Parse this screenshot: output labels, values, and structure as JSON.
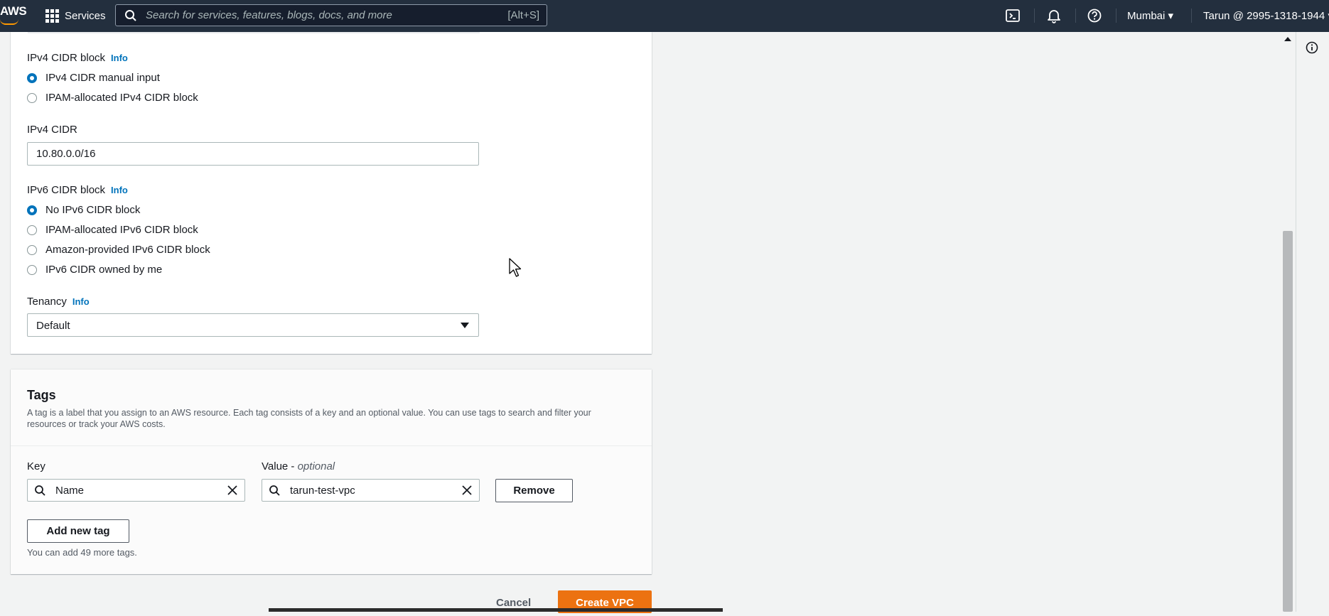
{
  "topnav": {
    "logo_text": "AWS",
    "services_label": "Services",
    "search_placeholder": "Search for services, features, blogs, docs, and more",
    "search_shortcut": "[Alt+S]",
    "region": "Mumbai",
    "account": "Tarun @ 2995-1318-1944",
    "icons": [
      "cloudshell-icon",
      "bell-icon",
      "help-icon"
    ]
  },
  "settings": {
    "ipv4_cidr_block_label": "IPv4 CIDR block",
    "info_label": "Info",
    "ipv4_options": [
      {
        "label": "IPv4 CIDR manual input",
        "selected": true
      },
      {
        "label": "IPAM-allocated IPv4 CIDR block",
        "selected": false
      }
    ],
    "ipv4_cidr_label": "IPv4 CIDR",
    "ipv4_cidr_value": "10.80.0.0/16",
    "ipv6_cidr_block_label": "IPv6 CIDR block",
    "ipv6_options": [
      {
        "label": "No IPv6 CIDR block",
        "selected": true
      },
      {
        "label": "IPAM-allocated IPv6 CIDR block",
        "selected": false
      },
      {
        "label": "Amazon-provided IPv6 CIDR block",
        "selected": false
      },
      {
        "label": "IPv6 CIDR owned by me",
        "selected": false
      }
    ],
    "tenancy_label": "Tenancy",
    "tenancy_value": "Default"
  },
  "tags": {
    "title": "Tags",
    "description": "A tag is a label that you assign to an AWS resource. Each tag consists of a key and an optional value. You can use tags to search and filter your resources or track your AWS costs.",
    "key_label": "Key",
    "value_label": "Value - ",
    "value_optional": "optional",
    "key_value": "Name",
    "value_value": "tarun-test-vpc",
    "remove_label": "Remove",
    "add_label": "Add new tag",
    "hint": "You can add 49 more tags."
  },
  "footer": {
    "cancel_label": "Cancel",
    "create_label": "Create VPC"
  },
  "colors": {
    "nav_bg": "#232f3e",
    "link": "#0073bb",
    "primary": "#ec7211",
    "page_bg": "#f2f3f3"
  }
}
